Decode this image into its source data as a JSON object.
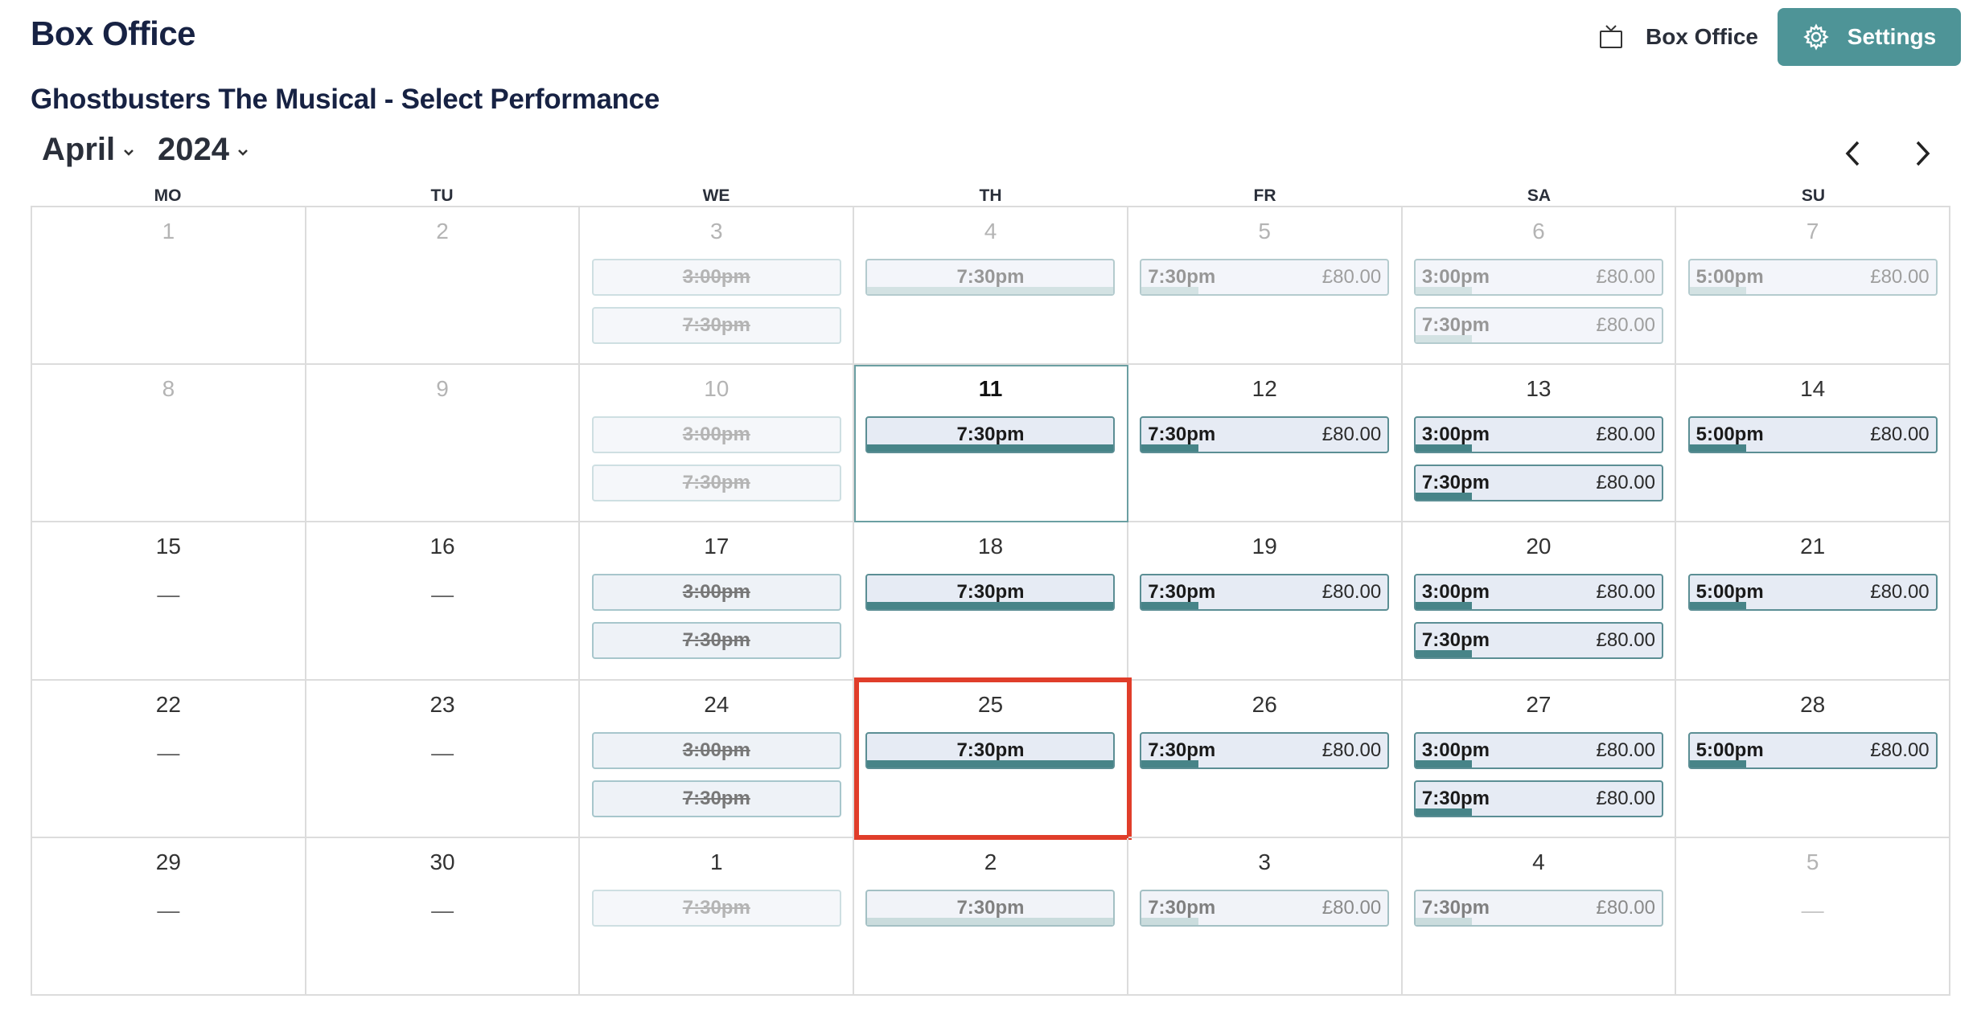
{
  "header": {
    "app_title": "Box Office",
    "box_office_link": "Box Office",
    "settings_label": "Settings"
  },
  "page_title": "Ghostbusters The Musical - Select Performance",
  "month_picker": {
    "month": "April",
    "year": "2024"
  },
  "weekdays": [
    "MO",
    "TU",
    "WE",
    "TH",
    "FR",
    "SA",
    "SU"
  ],
  "colors": {
    "accent": "#4e9497",
    "highlight": "#e03d2a",
    "bar": "#478488"
  },
  "weeks": [
    [
      {
        "day": "1",
        "muted": true,
        "perfs": []
      },
      {
        "day": "2",
        "muted": true,
        "perfs": []
      },
      {
        "day": "3",
        "muted": true,
        "perfs": [
          {
            "time": "3:00pm",
            "disabled": true
          },
          {
            "time": "7:30pm",
            "disabled": true
          }
        ]
      },
      {
        "day": "4",
        "muted": true,
        "perfs": [
          {
            "time": "7:30pm",
            "fill": 1.0
          }
        ]
      },
      {
        "day": "5",
        "muted": true,
        "perfs": [
          {
            "time": "7:30pm",
            "price": "£80.00",
            "fill": 0.23
          }
        ]
      },
      {
        "day": "6",
        "muted": true,
        "perfs": [
          {
            "time": "3:00pm",
            "price": "£80.00",
            "fill": 0.23
          },
          {
            "time": "7:30pm",
            "price": "£80.00",
            "fill": 0.23
          }
        ]
      },
      {
        "day": "7",
        "muted": true,
        "perfs": [
          {
            "time": "5:00pm",
            "price": "£80.00",
            "fill": 0.23
          }
        ]
      }
    ],
    [
      {
        "day": "8",
        "muted": true,
        "perfs": []
      },
      {
        "day": "9",
        "muted": true,
        "perfs": []
      },
      {
        "day": "10",
        "muted": true,
        "perfs": [
          {
            "time": "3:00pm",
            "disabled": true
          },
          {
            "time": "7:30pm",
            "disabled": true
          }
        ]
      },
      {
        "day": "11",
        "today": true,
        "perfs": [
          {
            "time": "7:30pm",
            "fill": 1.0
          }
        ]
      },
      {
        "day": "12",
        "perfs": [
          {
            "time": "7:30pm",
            "price": "£80.00",
            "fill": 0.23
          }
        ]
      },
      {
        "day": "13",
        "perfs": [
          {
            "time": "3:00pm",
            "price": "£80.00",
            "fill": 0.23
          },
          {
            "time": "7:30pm",
            "price": "£80.00",
            "fill": 0.23
          }
        ]
      },
      {
        "day": "14",
        "perfs": [
          {
            "time": "5:00pm",
            "price": "£80.00",
            "fill": 0.23
          }
        ]
      }
    ],
    [
      {
        "day": "15",
        "dash": "—",
        "perfs": []
      },
      {
        "day": "16",
        "dash": "—",
        "perfs": []
      },
      {
        "day": "17",
        "perfs": [
          {
            "time": "3:00pm",
            "disabled": true
          },
          {
            "time": "7:30pm",
            "disabled": true
          }
        ]
      },
      {
        "day": "18",
        "perfs": [
          {
            "time": "7:30pm",
            "fill": 1.0
          }
        ]
      },
      {
        "day": "19",
        "perfs": [
          {
            "time": "7:30pm",
            "price": "£80.00",
            "fill": 0.23
          }
        ]
      },
      {
        "day": "20",
        "perfs": [
          {
            "time": "3:00pm",
            "price": "£80.00",
            "fill": 0.23
          },
          {
            "time": "7:30pm",
            "price": "£80.00",
            "fill": 0.23
          }
        ]
      },
      {
        "day": "21",
        "perfs": [
          {
            "time": "5:00pm",
            "price": "£80.00",
            "fill": 0.23
          }
        ]
      }
    ],
    [
      {
        "day": "22",
        "dash": "—",
        "perfs": []
      },
      {
        "day": "23",
        "dash": "—",
        "perfs": []
      },
      {
        "day": "24",
        "perfs": [
          {
            "time": "3:00pm",
            "disabled": true
          },
          {
            "time": "7:30pm",
            "disabled": true
          }
        ]
      },
      {
        "day": "25",
        "highlight": true,
        "perfs": [
          {
            "time": "7:30pm",
            "fill": 1.0
          }
        ]
      },
      {
        "day": "26",
        "perfs": [
          {
            "time": "7:30pm",
            "price": "£80.00",
            "fill": 0.23
          }
        ]
      },
      {
        "day": "27",
        "perfs": [
          {
            "time": "3:00pm",
            "price": "£80.00",
            "fill": 0.23
          },
          {
            "time": "7:30pm",
            "price": "£80.00",
            "fill": 0.23
          }
        ]
      },
      {
        "day": "28",
        "perfs": [
          {
            "time": "5:00pm",
            "price": "£80.00",
            "fill": 0.23
          }
        ]
      }
    ],
    [
      {
        "day": "29",
        "dash": "—",
        "perfs": []
      },
      {
        "day": "30",
        "dash": "—",
        "perfs": []
      },
      {
        "day": "1",
        "perfs": [
          {
            "time": "7:30pm",
            "disabled": true,
            "faded": true
          }
        ]
      },
      {
        "day": "2",
        "perfs": [
          {
            "time": "7:30pm",
            "fill": 1.0,
            "faded": true
          }
        ]
      },
      {
        "day": "3",
        "perfs": [
          {
            "time": "7:30pm",
            "price": "£80.00",
            "fill": 0.23,
            "faded": true
          }
        ]
      },
      {
        "day": "4",
        "perfs": [
          {
            "time": "7:30pm",
            "price": "£80.00",
            "fill": 0.23,
            "faded": true
          }
        ]
      },
      {
        "day": "5",
        "muted": true,
        "dash": "—",
        "perfs": []
      }
    ]
  ]
}
